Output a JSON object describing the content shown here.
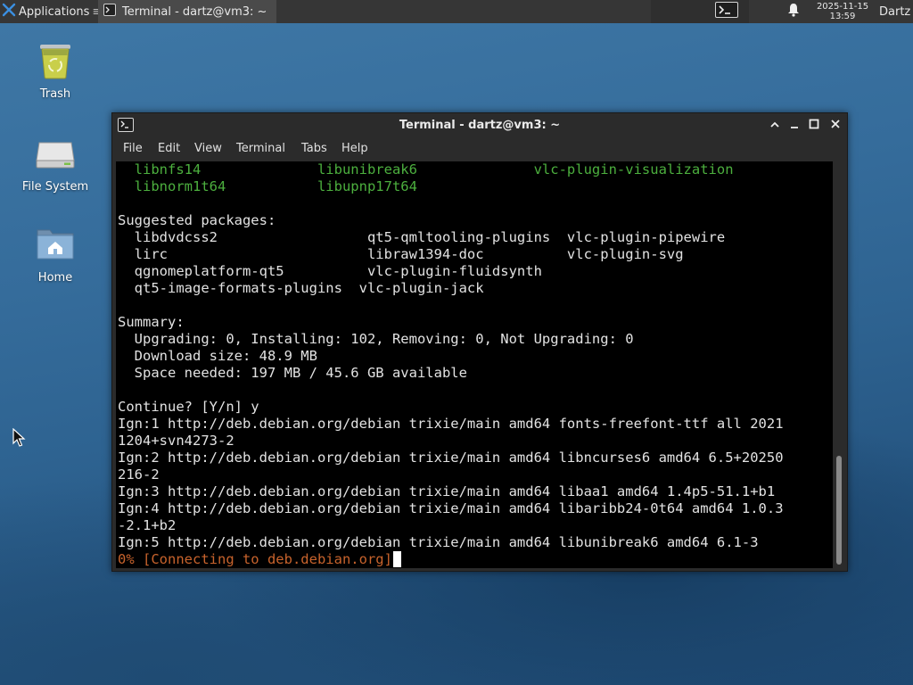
{
  "panel": {
    "applications_label": "Applications",
    "task_label": "Terminal - dartz@vm3: ~",
    "clock_date": "2025-11-15",
    "clock_time": "13:59",
    "user": "Dartz"
  },
  "desktop": {
    "icons": [
      {
        "label": "Trash",
        "icon": "trash-icon"
      },
      {
        "label": "File System",
        "icon": "drive-icon"
      },
      {
        "label": "Home",
        "icon": "home-folder-icon"
      }
    ]
  },
  "window": {
    "title": "Terminal - dartz@vm3: ~",
    "menu": [
      "File",
      "Edit",
      "View",
      "Terminal",
      "Tabs",
      "Help"
    ]
  },
  "terminal": {
    "lines": [
      {
        "text": "  libnfs14              libunibreak6              vlc-plugin-visualization",
        "style": "green"
      },
      {
        "text": "  libnorm1t64           libupnp17t64",
        "style": "green"
      },
      {
        "text": "",
        "style": ""
      },
      {
        "text": "Suggested packages:",
        "style": ""
      },
      {
        "text": "  libdvdcss2                  qt5-qmltooling-plugins  vlc-plugin-pipewire",
        "style": ""
      },
      {
        "text": "  lirc                        libraw1394-doc          vlc-plugin-svg",
        "style": ""
      },
      {
        "text": "  qgnomeplatform-qt5          vlc-plugin-fluidsynth",
        "style": ""
      },
      {
        "text": "  qt5-image-formats-plugins  vlc-plugin-jack",
        "style": ""
      },
      {
        "text": "",
        "style": ""
      },
      {
        "text": "Summary:",
        "style": ""
      },
      {
        "text": "  Upgrading: 0, Installing: 102, Removing: 0, Not Upgrading: 0",
        "style": ""
      },
      {
        "text": "  Download size: 48.9 MB",
        "style": ""
      },
      {
        "text": "  Space needed: 197 MB / 45.6 GB available",
        "style": ""
      },
      {
        "text": "",
        "style": ""
      },
      {
        "text": "Continue? [Y/n] y",
        "style": ""
      },
      {
        "text": "Ign:1 http://deb.debian.org/debian trixie/main amd64 fonts-freefont-ttf all 2021",
        "style": ""
      },
      {
        "text": "1204+svn4273-2",
        "style": ""
      },
      {
        "text": "Ign:2 http://deb.debian.org/debian trixie/main amd64 libncurses6 amd64 6.5+20250",
        "style": ""
      },
      {
        "text": "216-2",
        "style": ""
      },
      {
        "text": "Ign:3 http://deb.debian.org/debian trixie/main amd64 libaa1 amd64 1.4p5-51.1+b1",
        "style": ""
      },
      {
        "text": "Ign:4 http://deb.debian.org/debian trixie/main amd64 libaribb24-0t64 amd64 1.0.3",
        "style": ""
      },
      {
        "text": "-2.1+b2",
        "style": ""
      },
      {
        "text": "Ign:5 http://deb.debian.org/debian trixie/main amd64 libunibreak6 amd64 6.1-3",
        "style": ""
      }
    ],
    "progress_line": "0% [Connecting to deb.debian.org]"
  },
  "colors": {
    "panel_bg": "#363636",
    "window_bg": "#2b2b2b",
    "terminal_bg": "#000000",
    "terminal_fg": "#e2e2e2",
    "package_green": "#4caf3e",
    "progress_orange": "#c8632c"
  }
}
